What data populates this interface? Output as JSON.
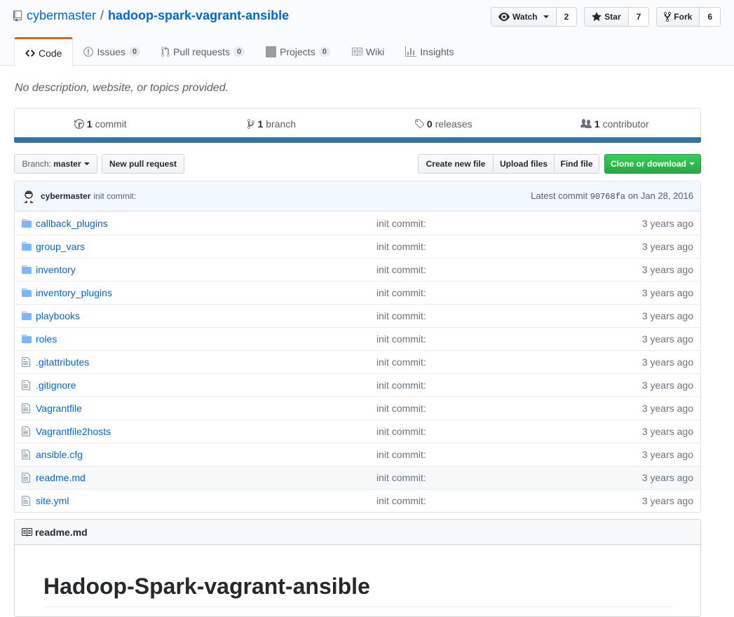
{
  "repo": {
    "owner": "cybermaster",
    "separator": "/",
    "name": "hadoop-spark-vagrant-ansible"
  },
  "actions": {
    "watch_label": "Watch",
    "watch_count": "2",
    "star_label": "Star",
    "star_count": "7",
    "fork_label": "Fork",
    "fork_count": "6"
  },
  "tabs": [
    {
      "label": "Code"
    },
    {
      "label": "Issues",
      "count": "0"
    },
    {
      "label": "Pull requests",
      "count": "0"
    },
    {
      "label": "Projects",
      "count": "0"
    },
    {
      "label": "Wiki"
    },
    {
      "label": "Insights"
    }
  ],
  "description": "No description, website, or topics provided.",
  "summary": {
    "commits_num": "1",
    "commits_label": "commit",
    "branches_num": "1",
    "branches_label": "branch",
    "releases_num": "0",
    "releases_label": "releases",
    "contributors_num": "1",
    "contributors_label": "contributor"
  },
  "language_color": "#3572a5",
  "branch": {
    "prefix": "Branch:",
    "name": "master"
  },
  "buttons": {
    "new_pr": "New pull request",
    "create_file": "Create new file",
    "upload_files": "Upload files",
    "find_file": "Find file",
    "clone": "Clone or download"
  },
  "latest_commit": {
    "author": "cybermaster",
    "message": "init commit:",
    "prefix": "Latest commit",
    "sha": "90768fa",
    "date": "on Jan 28, 2016"
  },
  "files": [
    {
      "name": "callback_plugins",
      "type": "dir",
      "message": "init commit:",
      "age": "3 years ago"
    },
    {
      "name": "group_vars",
      "type": "dir",
      "message": "init commit:",
      "age": "3 years ago"
    },
    {
      "name": "inventory",
      "type": "dir",
      "message": "init commit:",
      "age": "3 years ago"
    },
    {
      "name": "inventory_plugins",
      "type": "dir",
      "message": "init commit:",
      "age": "3 years ago"
    },
    {
      "name": "playbooks",
      "type": "dir",
      "message": "init commit:",
      "age": "3 years ago"
    },
    {
      "name": "roles",
      "type": "dir",
      "message": "init commit:",
      "age": "3 years ago"
    },
    {
      "name": ".gitattributes",
      "type": "file",
      "message": "init commit:",
      "age": "3 years ago"
    },
    {
      "name": ".gitignore",
      "type": "file",
      "message": "init commit:",
      "age": "3 years ago"
    },
    {
      "name": "Vagrantfile",
      "type": "file",
      "message": "init commit:",
      "age": "3 years ago"
    },
    {
      "name": "Vagrantfile2hosts",
      "type": "file",
      "message": "init commit:",
      "age": "3 years ago"
    },
    {
      "name": "ansible.cfg",
      "type": "file",
      "message": "init commit:",
      "age": "3 years ago"
    },
    {
      "name": "readme.md",
      "type": "file",
      "message": "init commit:",
      "age": "3 years ago"
    },
    {
      "name": "site.yml",
      "type": "file",
      "message": "init commit:",
      "age": "3 years ago"
    }
  ],
  "readme": {
    "filename": "readme.md",
    "heading": "Hadoop-Spark-vagrant-ansible"
  }
}
